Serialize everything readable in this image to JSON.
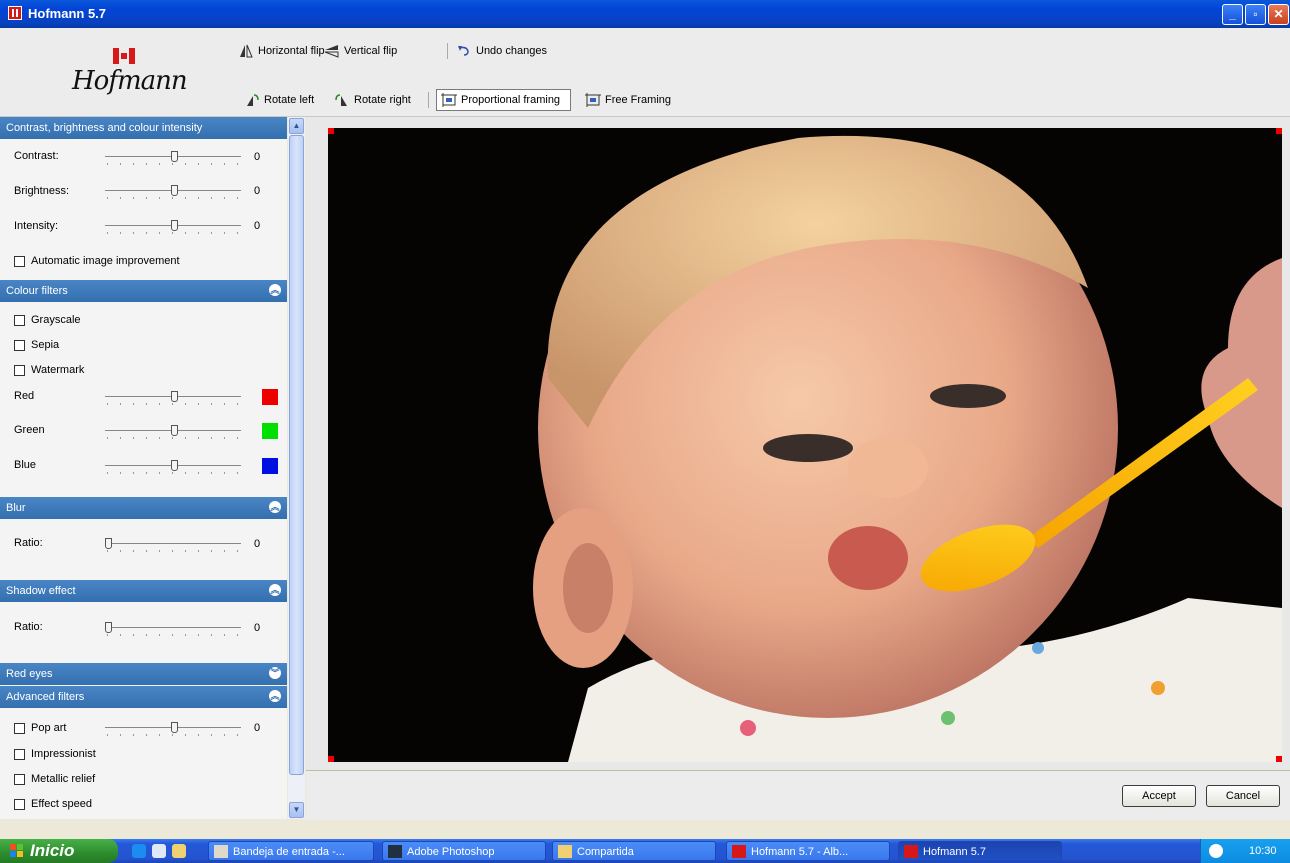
{
  "window": {
    "title": "Hofmann 5.7"
  },
  "logo": {
    "text": "Hofmann"
  },
  "toolbar": {
    "horizontal_flip": "Horizontal flip",
    "vertical_flip": "Vertical flip",
    "undo": "Undo changes",
    "rotate_left": "Rotate left",
    "rotate_right": "Rotate right",
    "proportional": "Proportional framing",
    "free": "Free Framing"
  },
  "panel": {
    "contrast_section": "Contrast, brightness and colour intensity",
    "contrast": {
      "label": "Contrast:",
      "value": "0"
    },
    "brightness": {
      "label": "Brightness:",
      "value": "0"
    },
    "intensity": {
      "label": "Intensity:",
      "value": "0"
    },
    "auto_improve": "Automatic image improvement",
    "colour_section": "Colour filters",
    "grayscale": "Grayscale",
    "sepia": "Sepia",
    "watermark": "Watermark",
    "red": "Red",
    "green": "Green",
    "blue": "Blue",
    "red_color": "#ee0000",
    "green_color": "#00e000",
    "blue_color": "#0010e0",
    "blur_section": "Blur",
    "blur_ratio": {
      "label": "Ratio:",
      "value": "0"
    },
    "shadow_section": "Shadow effect",
    "shadow_ratio": {
      "label": "Ratio:",
      "value": "0"
    },
    "redeyes_section": "Red eyes",
    "advanced_section": "Advanced filters",
    "popart": {
      "label": "Pop art",
      "value": "0"
    },
    "impressionist": "Impressionist",
    "metallic": "Metallic relief",
    "effect_speed": "Effect speed"
  },
  "buttons": {
    "accept": "Accept",
    "cancel": "Cancel"
  },
  "taskbar": {
    "start": "Inicio",
    "items": [
      "Bandeja de entrada -...",
      "Adobe Photoshop",
      "Compartida",
      "Hofmann 5.7  -  Alb...",
      "Hofmann 5.7"
    ],
    "clock": "10:30"
  }
}
